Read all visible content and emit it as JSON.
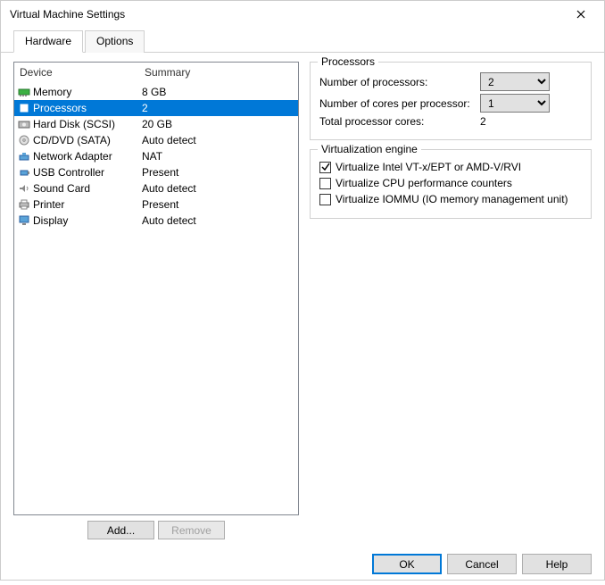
{
  "window": {
    "title": "Virtual Machine Settings"
  },
  "tabs": {
    "hardware": "Hardware",
    "options": "Options"
  },
  "headers": {
    "device": "Device",
    "summary": "Summary"
  },
  "devices": [
    {
      "name": "Memory",
      "summary": "8 GB",
      "icon": "memory"
    },
    {
      "name": "Processors",
      "summary": "2",
      "icon": "cpu",
      "selected": true
    },
    {
      "name": "Hard Disk (SCSI)",
      "summary": "20 GB",
      "icon": "hdd"
    },
    {
      "name": "CD/DVD (SATA)",
      "summary": "Auto detect",
      "icon": "cd"
    },
    {
      "name": "Network Adapter",
      "summary": "NAT",
      "icon": "net"
    },
    {
      "name": "USB Controller",
      "summary": "Present",
      "icon": "usb"
    },
    {
      "name": "Sound Card",
      "summary": "Auto detect",
      "icon": "sound"
    },
    {
      "name": "Printer",
      "summary": "Present",
      "icon": "printer"
    },
    {
      "name": "Display",
      "summary": "Auto detect",
      "icon": "display"
    }
  ],
  "buttons": {
    "add": "Add...",
    "remove": "Remove",
    "ok": "OK",
    "cancel": "Cancel",
    "help": "Help"
  },
  "processors": {
    "group_title": "Processors",
    "num_procs_label": "Number of processors:",
    "num_procs_value": "2",
    "cores_label": "Number of cores per processor:",
    "cores_value": "1",
    "total_label": "Total processor cores:",
    "total_value": "2"
  },
  "virt": {
    "group_title": "Virtualization engine",
    "vtx_label": "Virtualize Intel VT-x/EPT or AMD-V/RVI",
    "vtx_checked": true,
    "perf_label": "Virtualize CPU performance counters",
    "perf_checked": false,
    "iommu_label": "Virtualize IOMMU (IO memory management unit)",
    "iommu_checked": false
  }
}
